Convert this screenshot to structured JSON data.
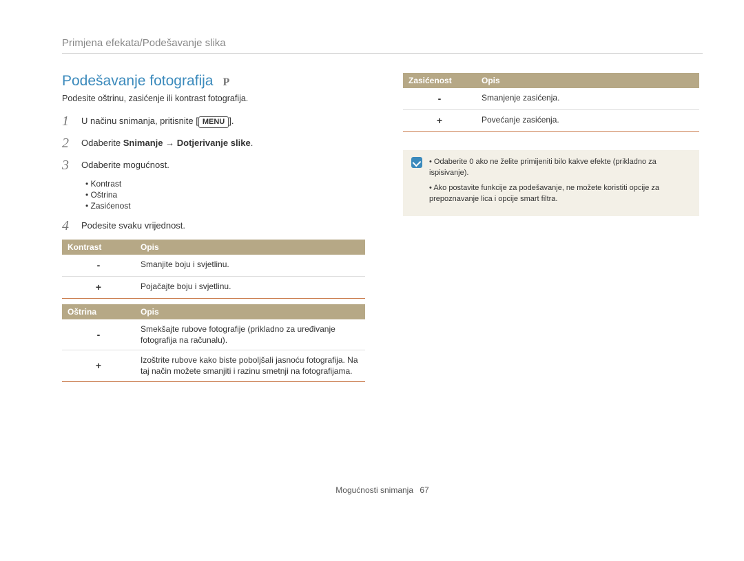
{
  "breadcrumb": "Primjena efekata/Podešavanje slika",
  "heading": "Podešavanje fotografija",
  "mode": "P",
  "intro": "Podesite oštrinu, zasićenje ili kontrast fotografija.",
  "steps": {
    "s1_pre": "U načinu snimanja, pritisnite ",
    "s1_btn": "MENU",
    "s1_post": ".",
    "s2_pre": "Odaberite ",
    "s2_b1": "Snimanje",
    "s2_arrow": " → ",
    "s2_b2": "Dotjerivanje slike",
    "s2_post": ".",
    "s3": "Odaberite mogućnost.",
    "s3_items": [
      "Kontrast",
      "Oštrina",
      "Zasićenost"
    ],
    "s4": "Podesite svaku vrijednost."
  },
  "tables": {
    "kontrast": {
      "h1": "Kontrast",
      "h2": "Opis",
      "r1a": "-",
      "r1b": "Smanjite boju i svjetlinu.",
      "r2a": "+",
      "r2b": "Pojačajte boju i svjetlinu."
    },
    "ostrina": {
      "h1": "Oštrina",
      "h2": "Opis",
      "r1a": "-",
      "r1b": "Smekšajte rubove fotografije (prikladno za uređivanje fotografija na računalu).",
      "r2a": "+",
      "r2b": "Izoštrite rubove kako biste poboljšali jasnoću fotografija. Na taj način možete smanjiti i razinu smetnji na fotografijama."
    },
    "zasicenost": {
      "h1": "Zasićenost",
      "h2": "Opis",
      "r1a": "-",
      "r1b": "Smanjenje zasićenja.",
      "r2a": "+",
      "r2b": "Povećanje zasićenja."
    }
  },
  "notes": [
    "Odaberite 0 ako ne želite primijeniti bilo kakve efekte (prikladno za ispisivanje).",
    "Ako postavite funkcije za podešavanje, ne možete koristiti opcije za prepoznavanje lica i opcije smart filtra."
  ],
  "footer_label": "Mogućnosti snimanja",
  "footer_page": "67"
}
